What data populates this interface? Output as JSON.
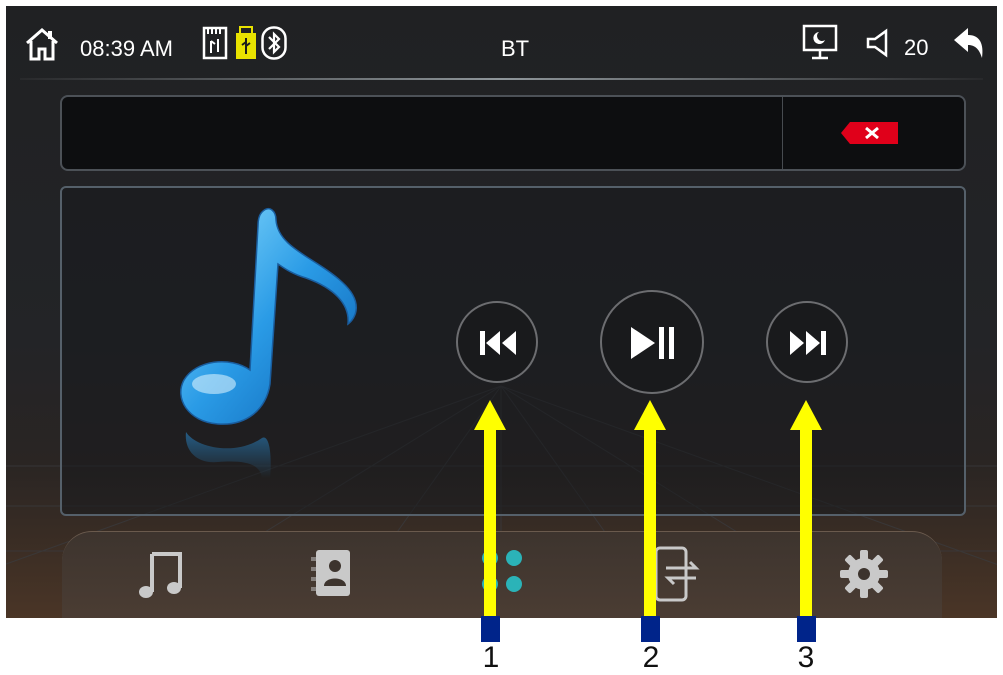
{
  "status_bar": {
    "time": "08:39 AM",
    "mode": "BT",
    "volume": "20",
    "icons": [
      "home-icon",
      "sd-card-icon",
      "usb-icon",
      "bluetooth-icon",
      "screen-off-icon",
      "volume-icon",
      "back-arrow-icon"
    ]
  },
  "device_box": {
    "device_name": "",
    "delete_icon": "delete-icon"
  },
  "player": {
    "album_art_icon": "music-note-icon",
    "controls": [
      {
        "name": "previous-button",
        "icon": "skip-previous-icon"
      },
      {
        "name": "play-pause-button",
        "icon": "play-pause-icon"
      },
      {
        "name": "next-button",
        "icon": "skip-next-icon"
      }
    ]
  },
  "bottom_nav": {
    "items": [
      {
        "name": "nav-music",
        "icon": "music-note-icon"
      },
      {
        "name": "nav-contacts",
        "icon": "contacts-book-icon"
      },
      {
        "name": "nav-dialpad",
        "icon": "dialpad-icon"
      },
      {
        "name": "nav-phone-transfer",
        "icon": "phone-transfer-icon"
      },
      {
        "name": "nav-settings",
        "icon": "gear-icon"
      }
    ]
  },
  "annotations": {
    "labels": [
      "1",
      "2",
      "3"
    ],
    "arrow_color": "#ffff00",
    "marker_color": "#00248a"
  },
  "colors": {
    "accent": "#2bb3b8",
    "delete_red": "#e0001a",
    "usb_yellow": "#e8e200"
  }
}
